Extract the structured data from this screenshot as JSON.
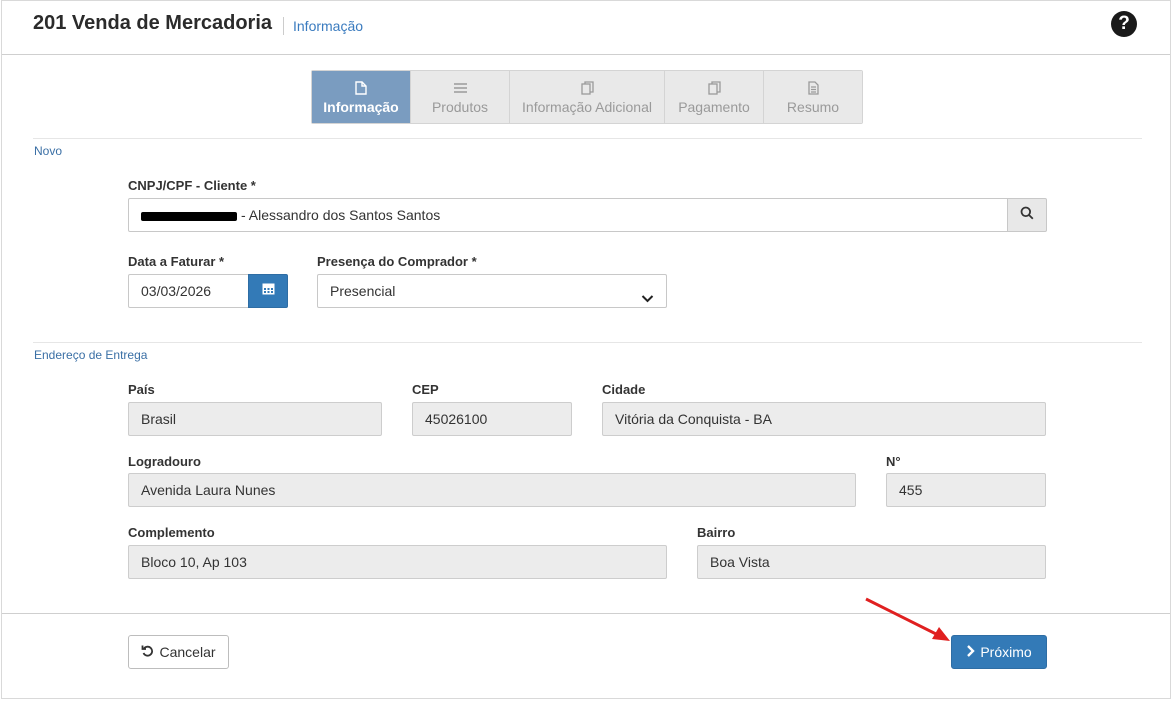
{
  "header": {
    "title": "201 Venda de Mercadoria",
    "subtitle": "Informação",
    "help_icon": "question-circle-icon"
  },
  "tabs": [
    {
      "label": "Informação",
      "icon": "file-icon",
      "active": true
    },
    {
      "label": "Produtos",
      "icon": "list-icon",
      "active": false
    },
    {
      "label": "Informação Adicional",
      "icon": "copy-icon",
      "active": false
    },
    {
      "label": "Pagamento",
      "icon": "copy-icon",
      "active": false
    },
    {
      "label": "Resumo",
      "icon": "document-icon",
      "active": false
    }
  ],
  "sections": {
    "novo": "Novo",
    "endereco": "Endereço de Entrega"
  },
  "cliente": {
    "label": "CNPJ/CPF - Cliente *",
    "value": "- Alessandro dos Santos Santos"
  },
  "data_faturar": {
    "label": "Data a Faturar *",
    "value": "03/03/2026"
  },
  "presenca": {
    "label": "Presença do Comprador *",
    "value": "Presencial"
  },
  "endereco": {
    "pais": {
      "label": "País",
      "value": "Brasil"
    },
    "cep": {
      "label": "CEP",
      "value": "45026100"
    },
    "cidade": {
      "label": "Cidade",
      "value": "Vitória da Conquista - BA"
    },
    "logradouro": {
      "label": "Logradouro",
      "value": "Avenida Laura Nunes"
    },
    "numero": {
      "label": "N°",
      "value": "455"
    },
    "complemento": {
      "label": "Complemento",
      "value": "Bloco 10, Ap 103"
    },
    "bairro": {
      "label": "Bairro",
      "value": "Boa Vista"
    }
  },
  "footer": {
    "cancel_label": "Cancelar",
    "next_label": "Próximo"
  },
  "colors": {
    "primary": "#337ab7",
    "active_tab": "#7a9cc0",
    "section_label": "#3a6fa5",
    "annotation_arrow": "#e02020"
  }
}
